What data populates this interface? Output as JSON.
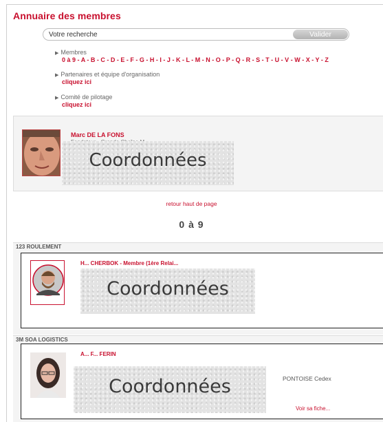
{
  "page": {
    "title": "Annuaire des membres"
  },
  "search": {
    "placeholder": "Votre recherche",
    "button_label": "Valider"
  },
  "directory": {
    "members_label": "Membres",
    "letters": [
      "0 à 9",
      "A",
      "B",
      "C",
      "D",
      "E",
      "F",
      "G",
      "H",
      "I",
      "J",
      "K",
      "L",
      "M",
      "N",
      "O",
      "P",
      "Q",
      "R",
      "S",
      "T",
      "U",
      "V",
      "W",
      "X",
      "Y",
      "Z"
    ],
    "partners_label": "Partenaires et équipe d'organisation",
    "partners_link": "cliquez ici",
    "committee_label": "Comité de pilotage",
    "committee_link": "cliquez ici"
  },
  "featured": {
    "name": "Marc DE LA FONS",
    "subtitle": "Fondateur - Grande Chaîne M...",
    "overlay": "Coordonnées"
  },
  "back_to_top": "retour haut de page",
  "section": {
    "title": "0 à 9"
  },
  "companies": [
    {
      "name": "123 ROULEMENT",
      "member_name": "H... CHERBOK - Membre (1ère Relai...",
      "overlay": "Coordonnées"
    },
    {
      "name": "3M SOA LOGISTICS",
      "member_name": "A... F... FERIN",
      "overlay": "Coordonnées",
      "city": "PONTOISE Cedex",
      "link": "Voir sa fiche..."
    }
  ],
  "colors": {
    "accent": "#c8102e",
    "panel": "#f4f4f4"
  }
}
